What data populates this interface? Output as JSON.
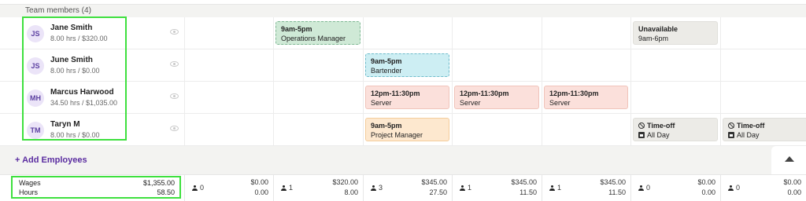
{
  "group": {
    "header": "Team members (4)"
  },
  "members": [
    {
      "initials": "JS",
      "name": "Jane Smith",
      "hours": "8.00 hrs / $320.00"
    },
    {
      "initials": "JS",
      "name": "June Smith",
      "hours": "8.00 hrs / $0.00"
    },
    {
      "initials": "MH",
      "name": "Marcus Harwood",
      "hours": "34.50 hrs / $1,035.00"
    },
    {
      "initials": "TM",
      "name": "Taryn M",
      "hours": "8.00 hrs / $0.00"
    }
  ],
  "shifts": {
    "jane_mon": {
      "time": "9am-5pm",
      "role": "Operations Manager"
    },
    "jane_fri": {
      "time": "Unavailable",
      "role": "9am-6pm"
    },
    "june_tue": {
      "time": "9am-5pm",
      "role": "Bartender"
    },
    "marcus_tue": {
      "time": "12pm-11:30pm",
      "role": "Server"
    },
    "marcus_wed": {
      "time": "12pm-11:30pm",
      "role": "Server"
    },
    "marcus_thu": {
      "time": "12pm-11:30pm",
      "role": "Server"
    },
    "taryn_tue": {
      "time": "9am-5pm",
      "role": "Project Manager"
    },
    "taryn_fri": {
      "time": "Time-off",
      "role": "All Day"
    },
    "taryn_sat": {
      "time": "Time-off",
      "role": "All Day"
    }
  },
  "actions": {
    "add_employees": "+ Add Employees"
  },
  "totals": {
    "wages_label": "Wages",
    "hours_label": "Hours",
    "wages": "$1,355.00",
    "hours": "58.50"
  },
  "footer_cols": [
    {
      "staff": "0",
      "wages": "$0.00",
      "hours": "0.00"
    },
    {
      "staff": "1",
      "wages": "$320.00",
      "hours": "8.00"
    },
    {
      "staff": "3",
      "wages": "$345.00",
      "hours": "27.50"
    },
    {
      "staff": "1",
      "wages": "$345.00",
      "hours": "11.50"
    },
    {
      "staff": "1",
      "wages": "$345.00",
      "hours": "11.50"
    },
    {
      "staff": "0",
      "wages": "$0.00",
      "hours": "0.00"
    },
    {
      "staff": "0",
      "wages": "$0.00",
      "hours": "0.00"
    }
  ],
  "icons": [
    "eye-icon",
    "ban-icon",
    "calendar-icon",
    "person-icon",
    "chevron-up-icon"
  ],
  "colors": {
    "accent": "#5a2ca0",
    "highlight": "#3ee03e",
    "shift_green": "#cfe9d6",
    "shift_blue": "#cdeef3",
    "shift_red": "#fbe0db",
    "shift_orange": "#fde8cf",
    "shift_grey": "#ecebe7"
  }
}
